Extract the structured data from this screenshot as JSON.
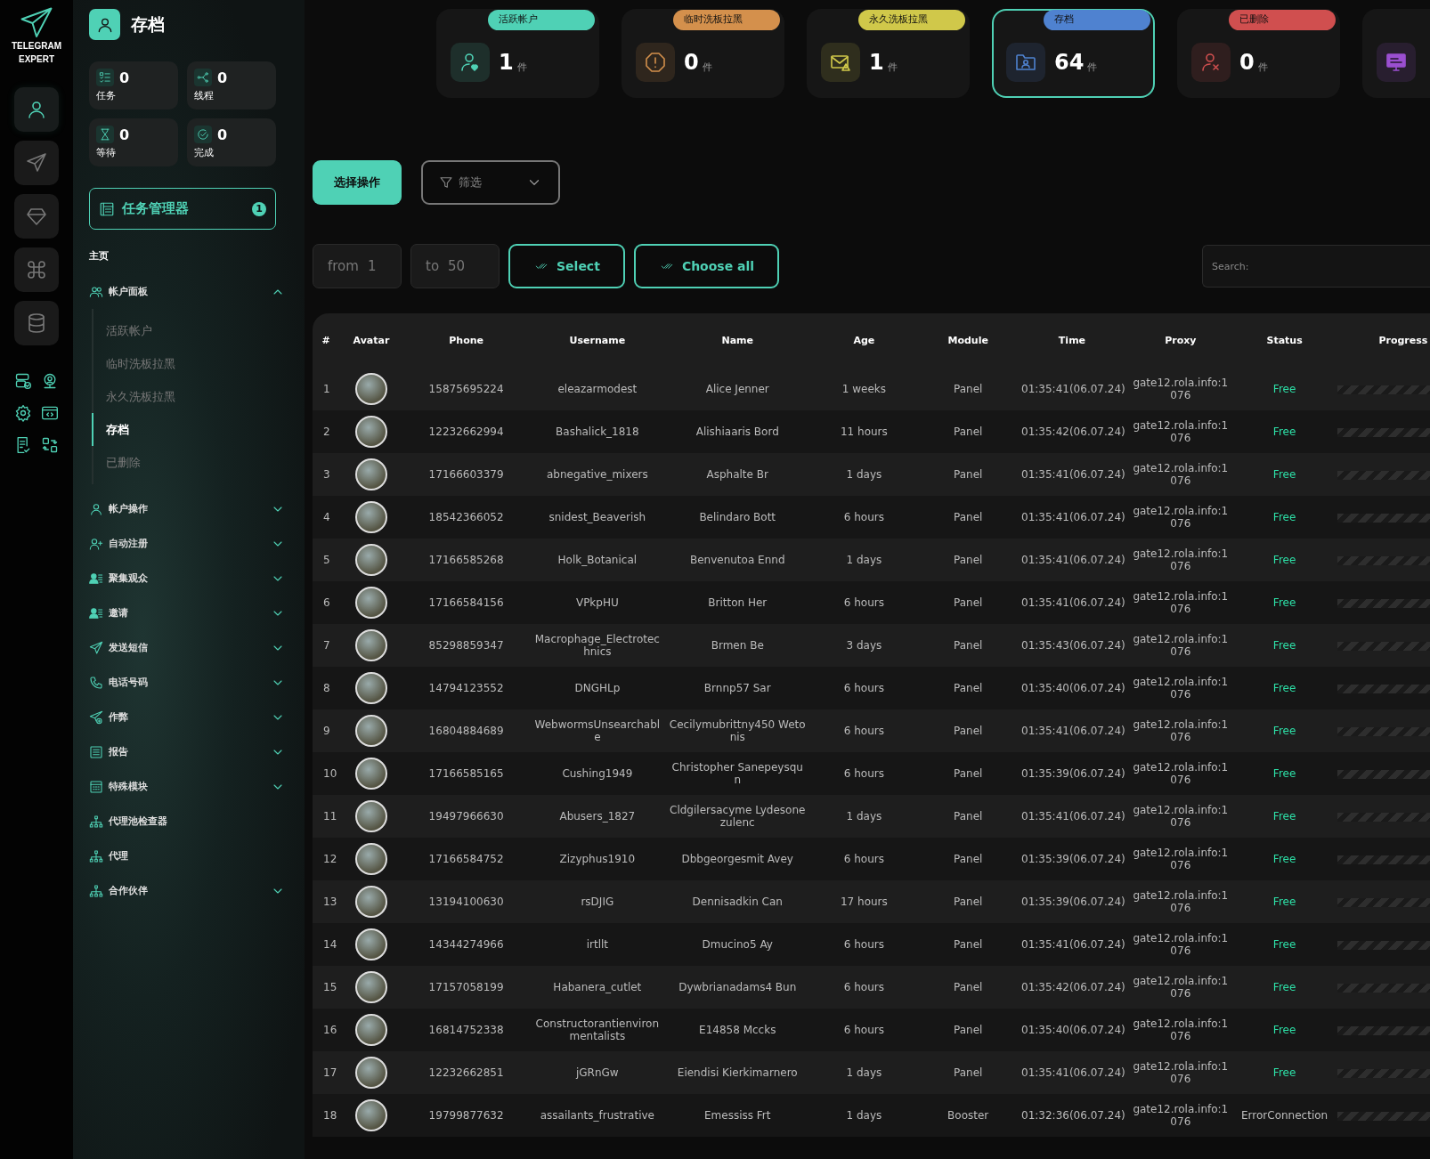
{
  "brand": {
    "line1": "TELEGRAM",
    "line2": "EXPERT"
  },
  "rail": {
    "main_icons": [
      {
        "selected": true
      },
      {
        "selected": false
      },
      {
        "selected": false
      },
      {
        "selected": false
      },
      {
        "selected": false
      }
    ]
  },
  "page_title": "存档",
  "stats": [
    {
      "value": "0",
      "label": "任务"
    },
    {
      "value": "0",
      "label": "线程"
    },
    {
      "value": "0",
      "label": "等待"
    },
    {
      "value": "0",
      "label": "完成"
    }
  ],
  "task_manager": {
    "label": "任务管理器",
    "badge": "1"
  },
  "menu": [
    {
      "kind": "heading",
      "label": "主页"
    },
    {
      "kind": "group",
      "label": "帐户面板",
      "expanded": true,
      "children": [
        {
          "label": "活跃帐户",
          "selected": false
        },
        {
          "label": "临时洗板拉黑",
          "selected": false
        },
        {
          "label": "永久洗板拉黑",
          "selected": false
        },
        {
          "label": "存档",
          "selected": true
        },
        {
          "label": "已删除",
          "selected": false
        }
      ]
    },
    {
      "kind": "group",
      "label": "帐户操作",
      "expanded": false
    },
    {
      "kind": "group",
      "label": "自动注册",
      "expanded": false
    },
    {
      "kind": "group",
      "label": "聚集观众",
      "expanded": false
    },
    {
      "kind": "group",
      "label": "邀请",
      "expanded": false
    },
    {
      "kind": "group",
      "label": "发送短信",
      "expanded": false
    },
    {
      "kind": "group",
      "label": "电话号码",
      "expanded": false
    },
    {
      "kind": "group",
      "label": "作弊",
      "expanded": false
    },
    {
      "kind": "group",
      "label": "报告",
      "expanded": false
    },
    {
      "kind": "group",
      "label": "特殊模块",
      "expanded": false
    },
    {
      "kind": "link",
      "label": "代理池检查器"
    },
    {
      "kind": "link",
      "label": "代理"
    },
    {
      "kind": "group",
      "label": "合作伙伴",
      "expanded": false
    }
  ],
  "cards": [
    {
      "label": "活跃帐户",
      "color": "#4fd1b5",
      "count": "1",
      "unit": "件",
      "selected": false
    },
    {
      "label": "临时洗板拉黑",
      "color": "#d4904c",
      "count": "0",
      "unit": "件",
      "selected": false
    },
    {
      "label": "永久洗板拉黑",
      "color": "#d0c84a",
      "count": "1",
      "unit": "件",
      "selected": false
    },
    {
      "label": "存档",
      "color": "#4f82d0",
      "count": "64",
      "unit": "件",
      "selected": true
    },
    {
      "label": "已删除",
      "color": "#d04f4f",
      "count": "0",
      "unit": "件",
      "selected": false
    },
    {
      "color": "#9b4fd0",
      "selected": false
    }
  ],
  "actions": {
    "primary": "选择操作",
    "filter": "筛选"
  },
  "range": {
    "from_label": "from",
    "from_value": "1",
    "to_label": "to",
    "to_value": "50",
    "select": "Select",
    "choose_all": "Choose all",
    "search_label": "Search:"
  },
  "table": {
    "columns": [
      "#",
      "Avatar",
      "Phone",
      "Username",
      "Name",
      "Age",
      "Module",
      "Time",
      "Proxy",
      "Status",
      "Progress"
    ],
    "rows": [
      {
        "n": "1",
        "phone": "15875695224",
        "username": "eleazarmodest",
        "name": "Alice Jenner",
        "age": "1 weeks",
        "module": "Panel",
        "time": "01:35:41(06.07.24)",
        "proxy": "gate12.rola.info:1076",
        "status": {
          "text": "Free",
          "color": "#2de0a7"
        }
      },
      {
        "n": "2",
        "phone": "12232662994",
        "username": "Bashalick_1818",
        "name": "Alishiaaris Bord",
        "age": "11 hours",
        "module": "Panel",
        "time": "01:35:42(06.07.24)",
        "proxy": "gate12.rola.info:1076",
        "status": {
          "text": "Free",
          "color": "#2de0a7"
        }
      },
      {
        "n": "3",
        "phone": "17166603379",
        "username": "abnegative_mixers",
        "name": "Asphalte Br",
        "age": "1 days",
        "module": "Panel",
        "time": "01:35:41(06.07.24)",
        "proxy": "gate12.rola.info:1076",
        "status": {
          "text": "Free",
          "color": "#2de0a7"
        }
      },
      {
        "n": "4",
        "phone": "18542366052",
        "username": "snidest_Beaverish",
        "name": "Belindaro Bott",
        "age": "6 hours",
        "module": "Panel",
        "time": "01:35:41(06.07.24)",
        "proxy": "gate12.rola.info:1076",
        "status": {
          "text": "Free",
          "color": "#2de0a7"
        }
      },
      {
        "n": "5",
        "phone": "17166585268",
        "username": "Holk_Botanical",
        "name": "Benvenutoa Ennd",
        "age": "1 days",
        "module": "Panel",
        "time": "01:35:41(06.07.24)",
        "proxy": "gate12.rola.info:1076",
        "status": {
          "text": "Free",
          "color": "#2de0a7"
        }
      },
      {
        "n": "6",
        "phone": "17166584156",
        "username": "VPkpHU",
        "name": "Britton Her",
        "age": "6 hours",
        "module": "Panel",
        "time": "01:35:41(06.07.24)",
        "proxy": "gate12.rola.info:1076",
        "status": {
          "text": "Free",
          "color": "#2de0a7"
        }
      },
      {
        "n": "7",
        "phone": "85298859347",
        "username": "Macrophage_Electrotechnics",
        "name": "Brmen Be",
        "age": "3 days",
        "module": "Panel",
        "time": "01:35:43(06.07.24)",
        "proxy": "gate12.rola.info:1076",
        "status": {
          "text": "Free",
          "color": "#2de0a7"
        }
      },
      {
        "n": "8",
        "phone": "14794123552",
        "username": "DNGHLp",
        "name": "Brnnp57 Sar",
        "age": "6 hours",
        "module": "Panel",
        "time": "01:35:40(06.07.24)",
        "proxy": "gate12.rola.info:1076",
        "status": {
          "text": "Free",
          "color": "#2de0a7"
        }
      },
      {
        "n": "9",
        "phone": "16804884689",
        "username": "WebwormsUnsearchable",
        "name": "Cecilymubrittny450 Wetonis",
        "age": "6 hours",
        "module": "Panel",
        "time": "01:35:41(06.07.24)",
        "proxy": "gate12.rola.info:1076",
        "status": {
          "text": "Free",
          "color": "#2de0a7"
        }
      },
      {
        "n": "10",
        "phone": "17166585165",
        "username": "Cushing1949",
        "name": "Christopher Sanepeysqun",
        "age": "6 hours",
        "module": "Panel",
        "time": "01:35:39(06.07.24)",
        "proxy": "gate12.rola.info:1076",
        "status": {
          "text": "Free",
          "color": "#2de0a7"
        }
      },
      {
        "n": "11",
        "phone": "19497966630",
        "username": "Abusers_1827",
        "name": "Cldgilersacyme Lydesonezulenc",
        "age": "1 days",
        "module": "Panel",
        "time": "01:35:41(06.07.24)",
        "proxy": "gate12.rola.info:1076",
        "status": {
          "text": "Free",
          "color": "#2de0a7"
        }
      },
      {
        "n": "12",
        "phone": "17166584752",
        "username": "Zizyphus1910",
        "name": "Dbbgeorgesmit Avey",
        "age": "6 hours",
        "module": "Panel",
        "time": "01:35:39(06.07.24)",
        "proxy": "gate12.rola.info:1076",
        "status": {
          "text": "Free",
          "color": "#2de0a7"
        }
      },
      {
        "n": "13",
        "phone": "13194100630",
        "username": "rsDJIG",
        "name": "Dennisadkin Can",
        "age": "17 hours",
        "module": "Panel",
        "time": "01:35:39(06.07.24)",
        "proxy": "gate12.rola.info:1076",
        "status": {
          "text": "Free",
          "color": "#2de0a7"
        }
      },
      {
        "n": "14",
        "phone": "14344274966",
        "username": "irtllt",
        "name": "Dmucino5 Ay",
        "age": "6 hours",
        "module": "Panel",
        "time": "01:35:41(06.07.24)",
        "proxy": "gate12.rola.info:1076",
        "status": {
          "text": "Free",
          "color": "#2de0a7"
        }
      },
      {
        "n": "15",
        "phone": "17157058199",
        "username": "Habanera_cutlet",
        "name": "Dywbrianadams4 Bun",
        "age": "6 hours",
        "module": "Panel",
        "time": "01:35:42(06.07.24)",
        "proxy": "gate12.rola.info:1076",
        "status": {
          "text": "Free",
          "color": "#2de0a7"
        }
      },
      {
        "n": "16",
        "phone": "16814752338",
        "username": "Constructorantienvironmentalists",
        "name": "E14858 Mccks",
        "age": "6 hours",
        "module": "Panel",
        "time": "01:35:40(06.07.24)",
        "proxy": "gate12.rola.info:1076",
        "status": {
          "text": "Free",
          "color": "#2de0a7"
        }
      },
      {
        "n": "17",
        "phone": "12232662851",
        "username": "jGRnGw",
        "name": "Eiendisi Kierkimarnero",
        "age": "1 days",
        "module": "Panel",
        "time": "01:35:41(06.07.24)",
        "proxy": "gate12.rola.info:1076",
        "status": {
          "text": "Free",
          "color": "#2de0a7"
        }
      },
      {
        "n": "18",
        "phone": "19799877632",
        "username": "assailants_frustrative",
        "name": "Emessiss Frt",
        "age": "1 days",
        "module": "Booster",
        "time": "01:32:36(06.07.24)",
        "proxy": "gate12.rola.info:1076",
        "status": {
          "text": "ErrorConnection",
          "color": "#bdbdbd"
        }
      }
    ]
  }
}
